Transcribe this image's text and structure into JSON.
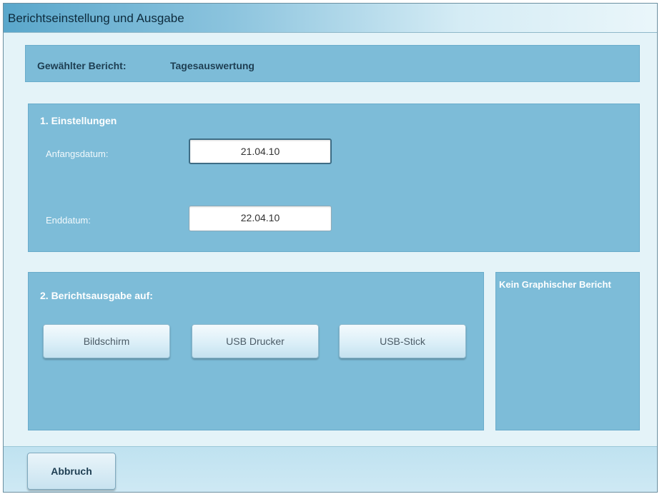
{
  "window": {
    "title": "Berichtseinstellung und Ausgabe"
  },
  "selected_report": {
    "label": "Gewählter Bericht:",
    "value": "Tagesauswertung"
  },
  "settings": {
    "heading": "1. Einstellungen",
    "start_date": {
      "label": "Anfangsdatum:",
      "value": "21.04.10"
    },
    "end_date": {
      "label": "Enddatum:",
      "value": "22.04.10"
    }
  },
  "output": {
    "heading": "2. Berichtsausgabe auf:",
    "buttons": [
      "Bildschirm",
      "USB Drucker",
      "USB-Stick"
    ]
  },
  "side_panel": {
    "text": "Kein Graphischer Bericht"
  },
  "footer": {
    "cancel_label": "Abbruch"
  }
}
